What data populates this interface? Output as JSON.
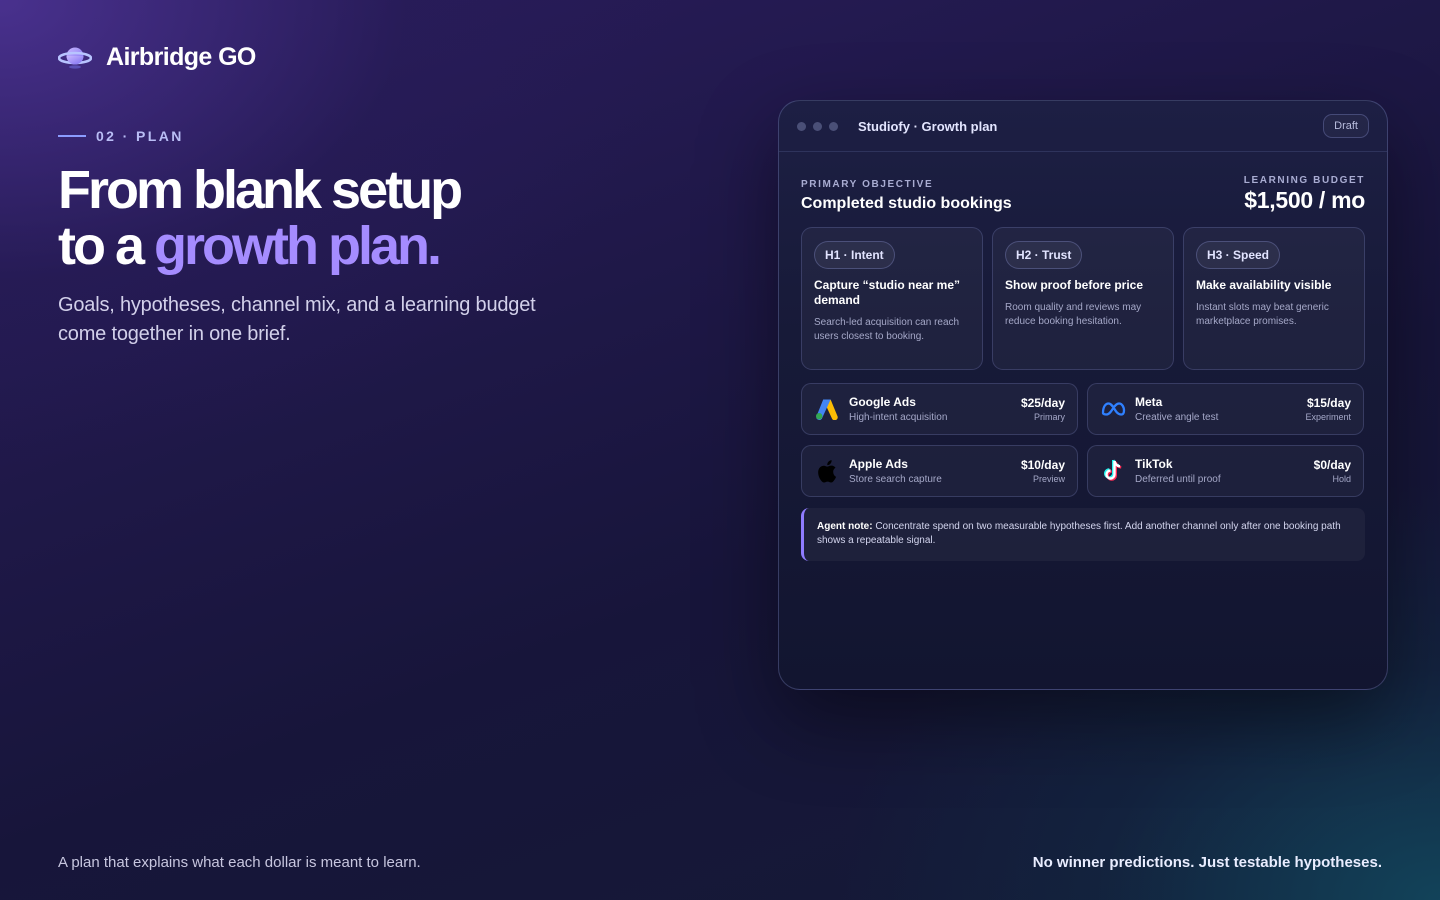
{
  "brand": {
    "name": "Airbridge GO",
    "icon": "planet-icon"
  },
  "hero": {
    "eyebrow": "02 · PLAN",
    "headline_line1": "From blank setup",
    "headline_line2_prefix": "to a ",
    "headline_line2_accent": "growth plan.",
    "subhead": "Goals, hypotheses, channel mix, and a learning budget come together in one brief."
  },
  "window": {
    "title": "Studiofy · Growth plan",
    "badge": "Draft",
    "objective_label": "PRIMARY OBJECTIVE",
    "objective_value": "Completed studio bookings",
    "budget_label": "LEARNING BUDGET",
    "budget_value": "$1,500 / mo",
    "hypotheses": [
      {
        "tag": "H1 · Intent",
        "title": "Capture “studio near me” demand",
        "desc": "Search-led acquisition can reach users closest to booking."
      },
      {
        "tag": "H2 · Trust",
        "title": "Show proof before price",
        "desc": "Room quality and reviews may reduce booking hesitation."
      },
      {
        "tag": "H3 · Speed",
        "title": "Make availability visible",
        "desc": "Instant slots may beat generic marketplace promises."
      }
    ],
    "channels": [
      {
        "icon": "google-ads-icon",
        "name": "Google Ads",
        "sub": "High-intent acquisition",
        "amount": "$25/day",
        "status": "Primary"
      },
      {
        "icon": "meta-icon",
        "name": "Meta",
        "sub": "Creative angle test",
        "amount": "$15/day",
        "status": "Experiment"
      },
      {
        "icon": "apple-icon",
        "name": "Apple Ads",
        "sub": "Store search capture",
        "amount": "$10/day",
        "status": "Preview"
      },
      {
        "icon": "tiktok-icon",
        "name": "TikTok",
        "sub": "Deferred until proof",
        "amount": "$0/day",
        "status": "Hold"
      }
    ],
    "note_label": "Agent note:",
    "note_text": " Concentrate spend on two measurable hypotheses first. Add another channel only after one booking path shows a repeatable signal."
  },
  "footer": {
    "left": "A plan that explains what each dollar is meant to learn.",
    "right": "No winner predictions. Just testable hypotheses."
  },
  "colors": {
    "accent": "#a58cff",
    "eyebrow_line": "#8b9cff",
    "note_border": "#8f7cff"
  }
}
